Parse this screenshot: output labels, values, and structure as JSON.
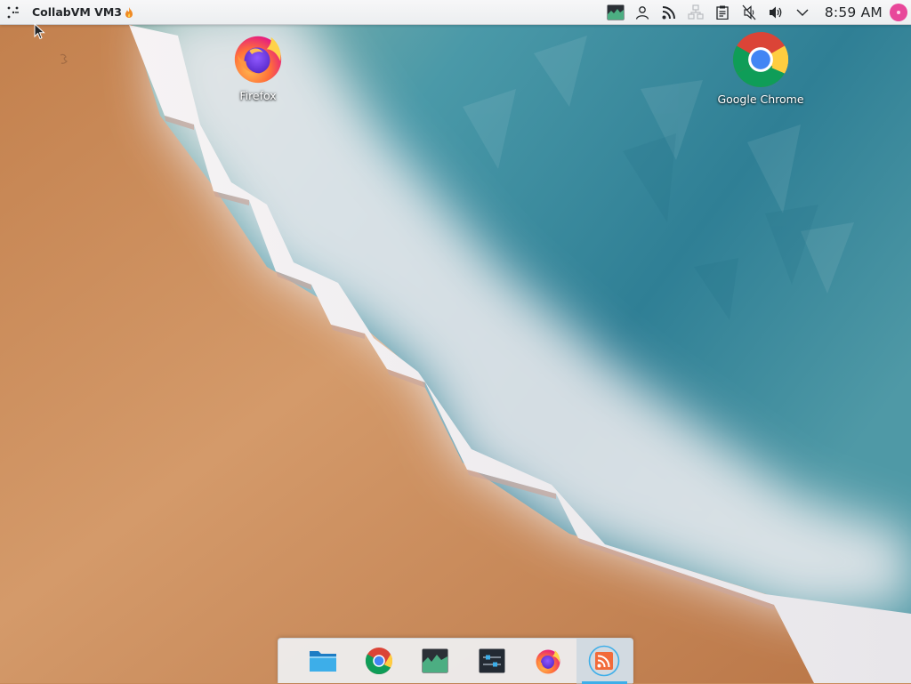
{
  "panel": {
    "title": "CollabVM VM3",
    "launcher_icon": "application-launcher-icon",
    "title_badge_icon": "flame-icon",
    "tray": [
      {
        "name": "system-monitor-icon"
      },
      {
        "name": "user-icon"
      },
      {
        "name": "rss-feed-icon"
      },
      {
        "name": "network-disconnected-icon"
      },
      {
        "name": "clipboard-icon"
      },
      {
        "name": "microphone-muted-icon"
      },
      {
        "name": "volume-icon"
      },
      {
        "name": "expand-tray-chevron-icon"
      }
    ],
    "clock": "8:59 AM",
    "user_avatar_color": "#e8479a"
  },
  "desktop": {
    "icons": [
      {
        "label": "Firefox",
        "icon": "firefox-icon"
      },
      {
        "label": "Google Chrome",
        "icon": "google-chrome-icon"
      }
    ]
  },
  "dock": {
    "items": [
      {
        "name": "file-manager-icon",
        "active": false
      },
      {
        "name": "google-chrome-icon",
        "active": false
      },
      {
        "name": "system-monitor-icon",
        "active": false
      },
      {
        "name": "system-settings-icon",
        "active": false
      },
      {
        "name": "firefox-icon",
        "active": false
      },
      {
        "name": "rss-reader-icon",
        "active": true
      }
    ]
  },
  "colors": {
    "sand": "#c98b5a",
    "foam": "#eef0f3",
    "sea": "#3f8fa0",
    "accent": "#3daee9"
  }
}
